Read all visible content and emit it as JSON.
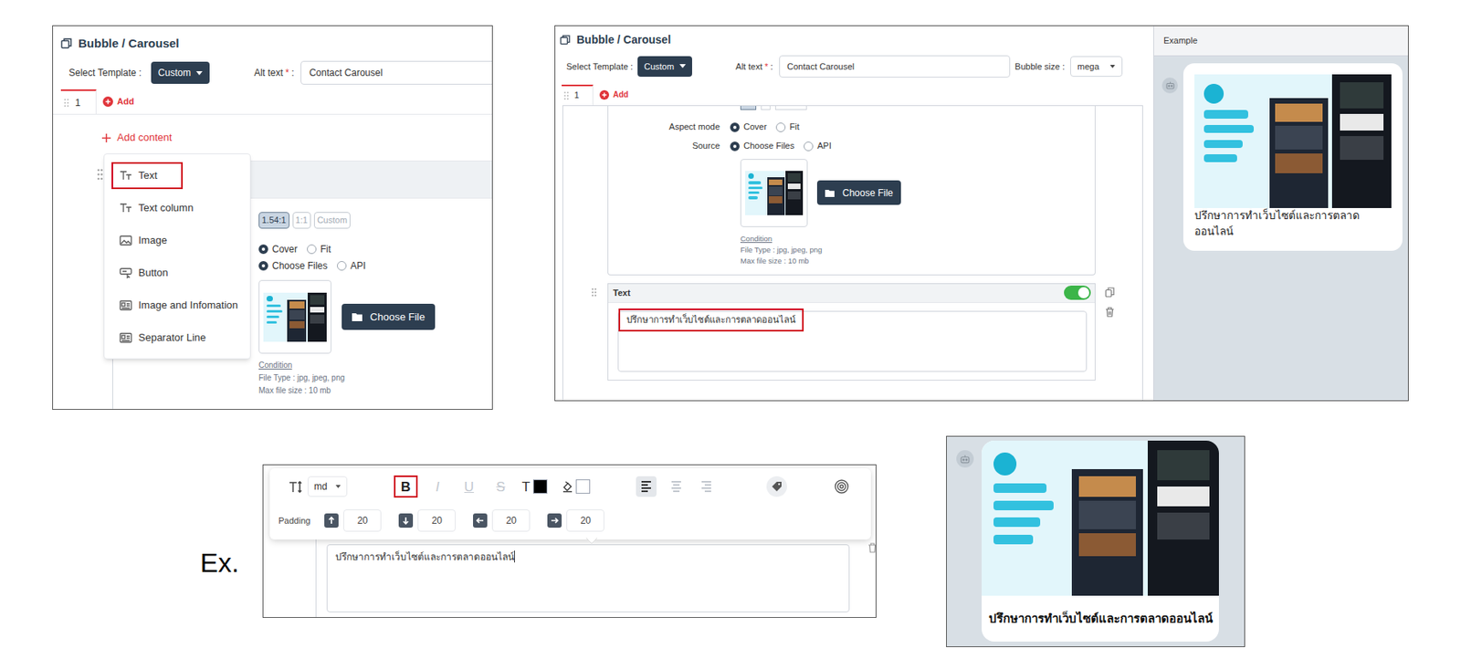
{
  "left_editor": {
    "title": "Bubble / Carousel",
    "select_template_label": "Select Template :",
    "template": "Custom",
    "alt_text_label": "Alt text",
    "required_mark": "*",
    "alt_text_colon": ":",
    "alt_text_value": "Contact Carousel",
    "tabs": [
      {
        "label": "1",
        "selected": true
      }
    ],
    "add_tab_label": "Add",
    "add_content_label": "Add content",
    "content_menu": [
      {
        "label": "Text",
        "kind": "text",
        "annotated": true
      },
      {
        "label": "Text column",
        "kind": "text",
        "annotated": false
      },
      {
        "label": "Image",
        "kind": "image",
        "annotated": false
      },
      {
        "label": "Button",
        "kind": "button",
        "annotated": false
      },
      {
        "label": "Image and Infomation",
        "kind": "card",
        "annotated": false
      },
      {
        "label": "Separator Line",
        "kind": "card",
        "annotated": false
      }
    ],
    "ratio_buttons": [
      {
        "label": "1.54:1",
        "selected": true
      },
      {
        "label": "1:1",
        "selected": false
      },
      {
        "label": "Custom",
        "selected": false
      }
    ],
    "aspect_options": [
      {
        "label": "Cover",
        "selected": true
      },
      {
        "label": "Fit",
        "selected": false
      }
    ],
    "source_options": [
      {
        "label": "Choose Files",
        "selected": true
      },
      {
        "label": "API",
        "selected": false
      }
    ],
    "choose_file_button": "Choose File",
    "condition_link": "Condition",
    "file_type_note": "File Type : jpg, jpeg, png",
    "max_size_note": "Max file size : 10 mb"
  },
  "right_editor": {
    "title": "Bubble / Carousel",
    "select_template_label": "Select Template :",
    "template": "Custom",
    "alt_text_label": "Alt text",
    "required_mark": "*",
    "alt_text_colon": ":",
    "alt_text_value": "Contact Carousel",
    "bubble_size_label": "Bubble size :",
    "bubble_size": "mega",
    "tabs": [
      {
        "label": "1",
        "selected": true
      }
    ],
    "add_tab_label": "Add",
    "aspect_mode_label": "Aspect mode",
    "aspect_options": [
      {
        "label": "Cover",
        "selected": true
      },
      {
        "label": "Fit",
        "selected": false
      }
    ],
    "source_label": "Source",
    "source_options": [
      {
        "label": "Choose Files",
        "selected": true
      },
      {
        "label": "API",
        "selected": false
      }
    ],
    "choose_file_button": "Choose File",
    "condition_link": "Condition",
    "file_type_note": "File Type : jpg, jpeg, png",
    "max_size_note": "Max file size : 10 mb",
    "text_block": {
      "title": "Text",
      "enabled": true,
      "value": "ปรึกษาการทำเว็บไซต์และการตลาดออนไลน์",
      "annotated": true
    }
  },
  "example_pane": {
    "title": "Example",
    "caption": "ปรึกษาการทำเว็บไซต์และการตลาดออนไลน์"
  },
  "example_label": "Ex.",
  "format_toolbar": {
    "size": "md",
    "style_buttons": [
      {
        "label": "B",
        "kind": "bold",
        "enabled": true,
        "annotated": true
      },
      {
        "label": "I",
        "kind": "italic",
        "enabled": false,
        "annotated": false
      },
      {
        "label": "U",
        "kind": "underline",
        "enabled": false,
        "annotated": false
      },
      {
        "label": "S",
        "kind": "strike",
        "enabled": false,
        "annotated": false
      }
    ],
    "text_color_label": "T",
    "text_color": "#000000",
    "background_color": "#ffffff",
    "align_buttons": [
      {
        "kind": "left",
        "selected": true
      },
      {
        "kind": "center",
        "selected": false
      },
      {
        "kind": "right",
        "selected": false
      }
    ],
    "padding_label": "Padding",
    "padding": [
      {
        "kind": "top",
        "value": "20"
      },
      {
        "kind": "bottom",
        "value": "20"
      },
      {
        "kind": "left",
        "value": "20"
      },
      {
        "kind": "right",
        "value": "20"
      }
    ],
    "text_value": "ปรึกษาการทำเว็บไซต์และการตลาดออนไลน์"
  },
  "example_preview": {
    "caption": "ปรึกษาการทำเว็บไซต์และการตลาดออนไลน์"
  }
}
